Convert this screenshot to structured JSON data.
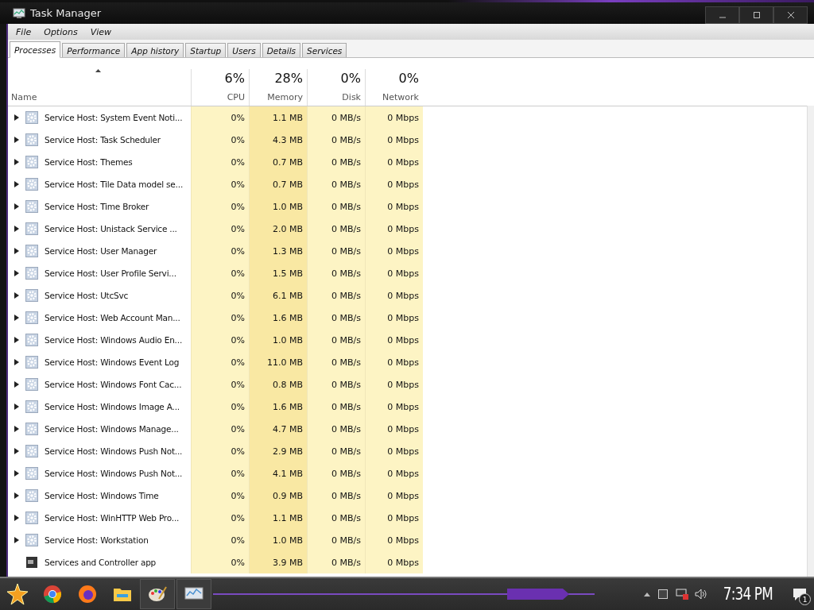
{
  "window": {
    "title": "Task Manager"
  },
  "menu": [
    "File",
    "Options",
    "View"
  ],
  "tabs": [
    {
      "label": "Processes",
      "selected": true
    },
    {
      "label": "Performance",
      "selected": false
    },
    {
      "label": "App history",
      "selected": false
    },
    {
      "label": "Startup",
      "selected": false
    },
    {
      "label": "Users",
      "selected": false
    },
    {
      "label": "Details",
      "selected": false
    },
    {
      "label": "Services",
      "selected": false
    }
  ],
  "columns": [
    {
      "label": "Name"
    },
    {
      "label": "CPU",
      "percent": "6%"
    },
    {
      "label": "Memory",
      "percent": "28%"
    },
    {
      "label": "Disk",
      "percent": "0%"
    },
    {
      "label": "Network",
      "percent": "0%"
    }
  ],
  "rows": [
    {
      "kind": "service",
      "name": "Service Host: System Event Noti...",
      "cpu": "0%",
      "memory": "1.1 MB",
      "disk": "0 MB/s",
      "network": "0 Mbps"
    },
    {
      "kind": "service",
      "name": "Service Host: Task Scheduler",
      "cpu": "0%",
      "memory": "4.3 MB",
      "disk": "0 MB/s",
      "network": "0 Mbps"
    },
    {
      "kind": "service",
      "name": "Service Host: Themes",
      "cpu": "0%",
      "memory": "0.7 MB",
      "disk": "0 MB/s",
      "network": "0 Mbps"
    },
    {
      "kind": "service",
      "name": "Service Host: Tile Data model se...",
      "cpu": "0%",
      "memory": "0.7 MB",
      "disk": "0 MB/s",
      "network": "0 Mbps"
    },
    {
      "kind": "service",
      "name": "Service Host: Time Broker",
      "cpu": "0%",
      "memory": "1.0 MB",
      "disk": "0 MB/s",
      "network": "0 Mbps"
    },
    {
      "kind": "service",
      "name": "Service Host: Unistack Service ...",
      "cpu": "0%",
      "memory": "2.0 MB",
      "disk": "0 MB/s",
      "network": "0 Mbps"
    },
    {
      "kind": "service",
      "name": "Service Host: User Manager",
      "cpu": "0%",
      "memory": "1.3 MB",
      "disk": "0 MB/s",
      "network": "0 Mbps"
    },
    {
      "kind": "service",
      "name": "Service Host: User Profile Servi...",
      "cpu": "0%",
      "memory": "1.5 MB",
      "disk": "0 MB/s",
      "network": "0 Mbps"
    },
    {
      "kind": "service",
      "name": "Service Host: UtcSvc",
      "cpu": "0%",
      "memory": "6.1 MB",
      "disk": "0 MB/s",
      "network": "0 Mbps"
    },
    {
      "kind": "service",
      "name": "Service Host: Web Account Man...",
      "cpu": "0%",
      "memory": "1.6 MB",
      "disk": "0 MB/s",
      "network": "0 Mbps"
    },
    {
      "kind": "service",
      "name": "Service Host: Windows Audio En...",
      "cpu": "0%",
      "memory": "1.0 MB",
      "disk": "0 MB/s",
      "network": "0 Mbps"
    },
    {
      "kind": "service",
      "name": "Service Host: Windows Event Log",
      "cpu": "0%",
      "memory": "11.0 MB",
      "disk": "0 MB/s",
      "network": "0 Mbps"
    },
    {
      "kind": "service",
      "name": "Service Host: Windows Font Cac...",
      "cpu": "0%",
      "memory": "0.8 MB",
      "disk": "0 MB/s",
      "network": "0 Mbps"
    },
    {
      "kind": "service",
      "name": "Service Host: Windows Image A...",
      "cpu": "0%",
      "memory": "1.6 MB",
      "disk": "0 MB/s",
      "network": "0 Mbps"
    },
    {
      "kind": "service",
      "name": "Service Host: Windows Manage...",
      "cpu": "0%",
      "memory": "4.7 MB",
      "disk": "0 MB/s",
      "network": "0 Mbps"
    },
    {
      "kind": "service",
      "name": "Service Host: Windows Push Not...",
      "cpu": "0%",
      "memory": "2.9 MB",
      "disk": "0 MB/s",
      "network": "0 Mbps"
    },
    {
      "kind": "service",
      "name": "Service Host: Windows Push Not...",
      "cpu": "0%",
      "memory": "4.1 MB",
      "disk": "0 MB/s",
      "network": "0 Mbps"
    },
    {
      "kind": "service",
      "name": "Service Host: Windows Time",
      "cpu": "0%",
      "memory": "0.9 MB",
      "disk": "0 MB/s",
      "network": "0 Mbps"
    },
    {
      "kind": "service",
      "name": "Service Host: WinHTTP Web Pro...",
      "cpu": "0%",
      "memory": "1.1 MB",
      "disk": "0 MB/s",
      "network": "0 Mbps"
    },
    {
      "kind": "service",
      "name": "Service Host: Workstation",
      "cpu": "0%",
      "memory": "1.0 MB",
      "disk": "0 MB/s",
      "network": "0 Mbps"
    },
    {
      "kind": "app",
      "name": "Services and Controller app",
      "cpu": "0%",
      "memory": "3.9 MB",
      "disk": "0 MB/s",
      "network": "0 Mbps"
    }
  ],
  "taskbar": {
    "clock": "7:34 PM",
    "notifications": "1"
  }
}
